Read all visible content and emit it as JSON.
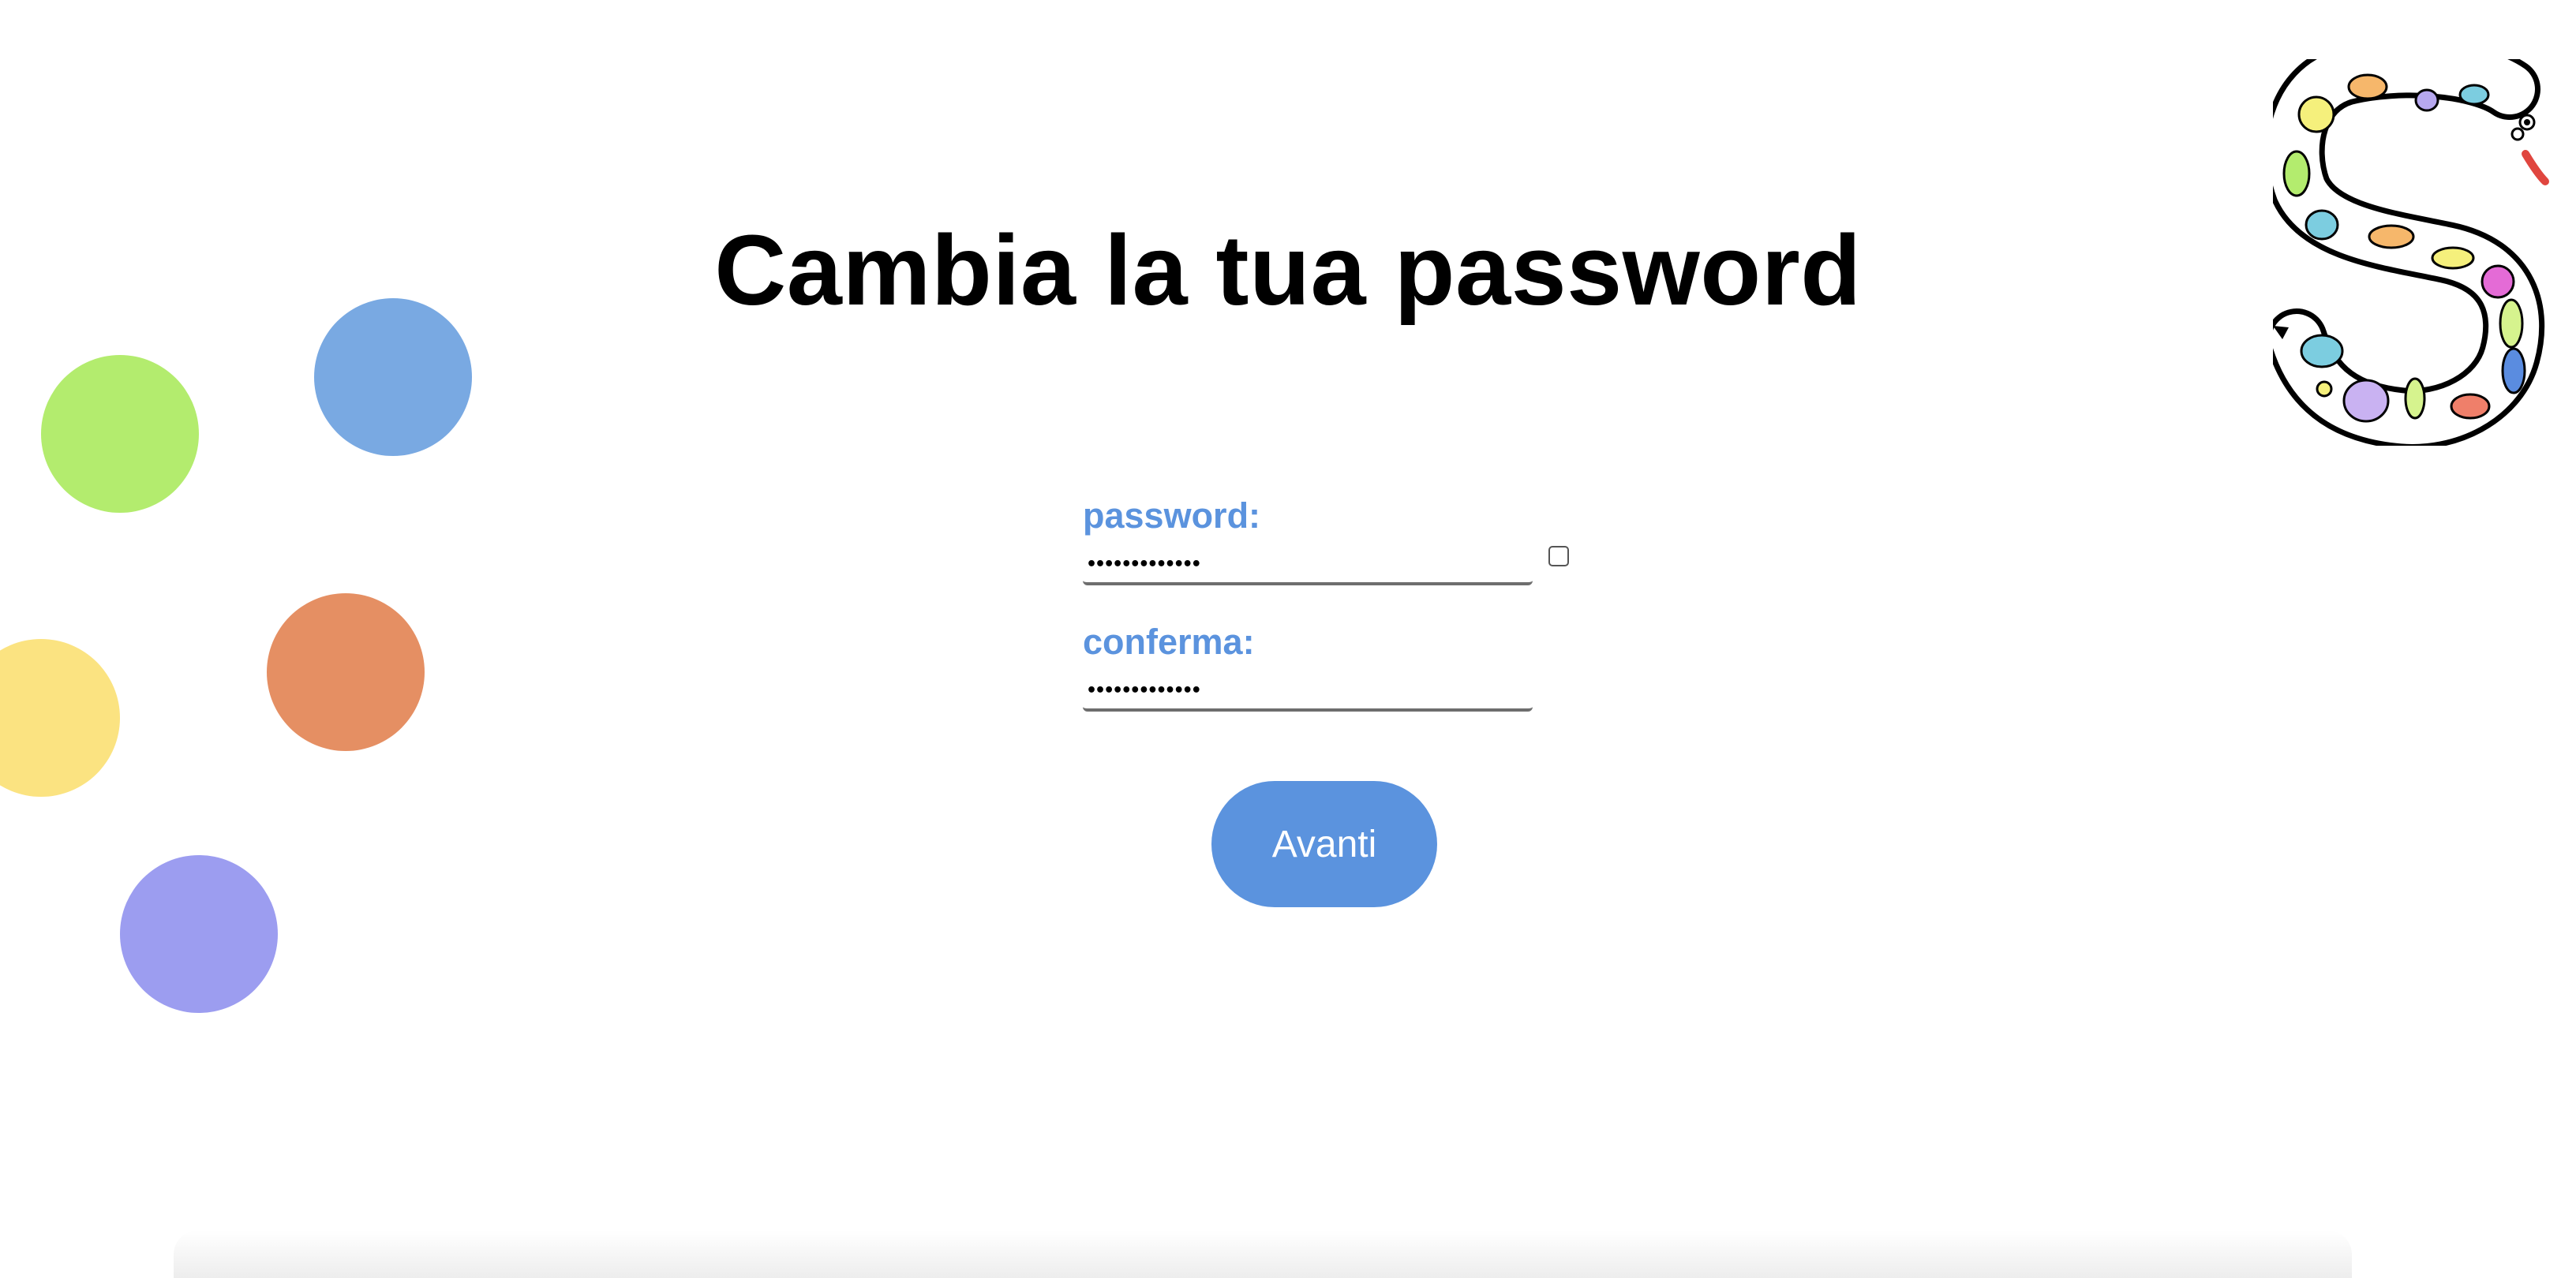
{
  "page": {
    "title": "Cambia la tua password"
  },
  "form": {
    "password": {
      "label": "password:",
      "value": "•••••••••••••",
      "show_toggle_checked": false
    },
    "confirm": {
      "label": "conferma:",
      "value": "•••••••••••••"
    },
    "submit_label": "Avanti"
  },
  "decorations": {
    "dot_colors": [
      "#b3ec6e",
      "#79a9e2",
      "#e58f63",
      "#fbe381",
      "#9c9df0"
    ],
    "logo_icon": "spotted-snake-s-logo"
  },
  "colors": {
    "accent": "#5b93de",
    "title": "#000000",
    "background": "#ffffff"
  }
}
